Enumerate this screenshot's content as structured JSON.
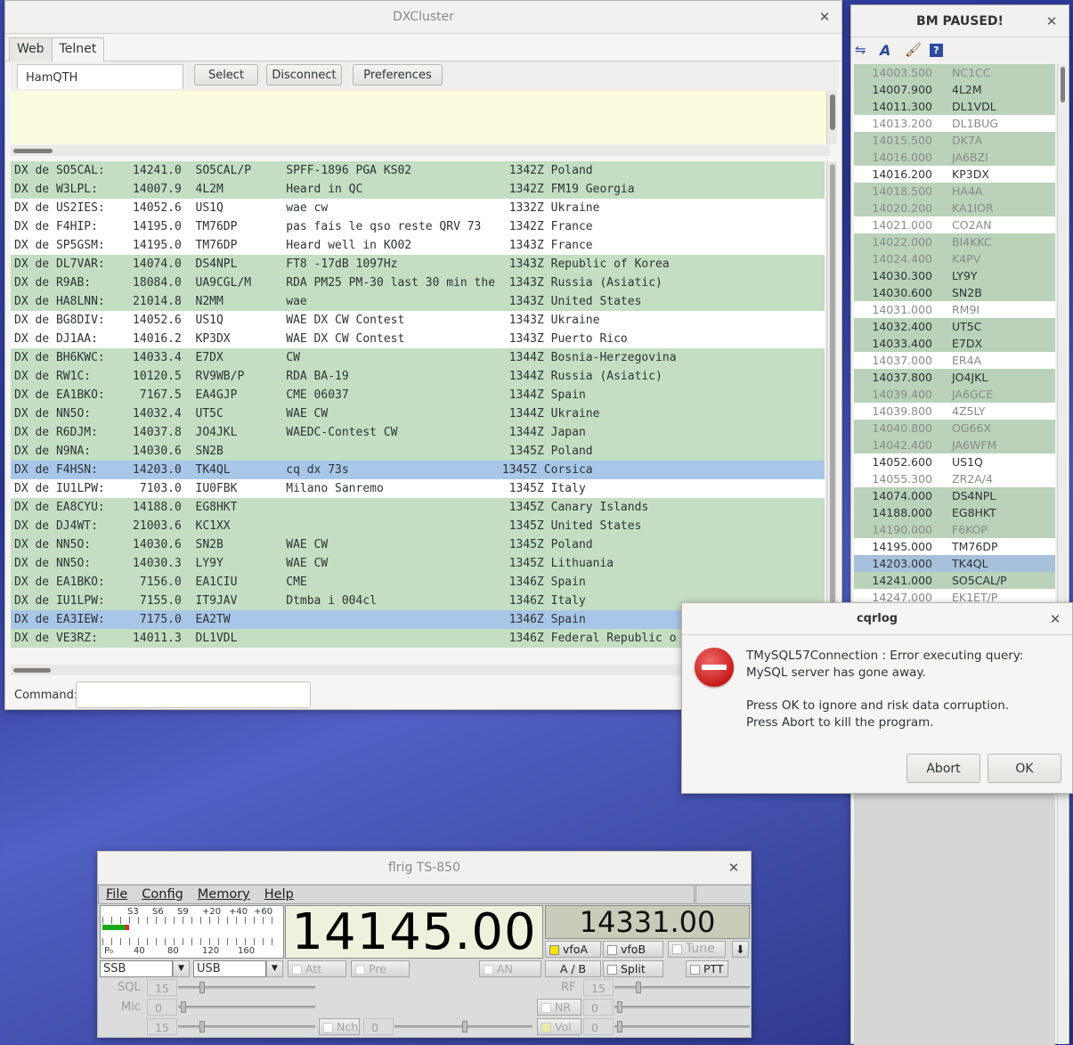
{
  "dxcluster": {
    "title": "DXCluster",
    "tabs": [
      "Web",
      "Telnet"
    ],
    "server": "HamQTH",
    "select_label": "Select",
    "disconnect_label": "Disconnect",
    "preferences_label": "Preferences",
    "command_label": "Command:",
    "rows": [
      {
        "t": "DX de SO5CAL:    14241.0  SO5CAL/P     SPFF-1896 PGA KS02              1342Z Poland",
        "c": "g"
      },
      {
        "t": "DX de W3LPL:     14007.9  4L2M         Heard in QC                     1342Z FM19 Georgia",
        "c": "g"
      },
      {
        "t": "DX de US2IES:    14052.6  US1Q         wae cw                          1332Z Ukraine",
        "c": ""
      },
      {
        "t": "DX de F4HIP:     14195.0  TM76DP       pas fais le qso reste QRV 73    1342Z France",
        "c": ""
      },
      {
        "t": "DX de SP5GSM:    14195.0  TM76DP       Heard well in KO02              1343Z France",
        "c": ""
      },
      {
        "t": "DX de DL7VAR:    14074.0  DS4NPL       FT8 -17dB 1097Hz                1343Z Republic of Korea",
        "c": "g"
      },
      {
        "t": "DX de R9AB:      18084.0  UA9CGL/M     RDA PM25 PM-30 last 30 min the  1343Z Russia (Asiatic)",
        "c": "g"
      },
      {
        "t": "DX de HA8LNN:    21014.8  N2MM         wae                             1343Z United States",
        "c": "g"
      },
      {
        "t": "DX de BG8DIV:    14052.6  US1Q         WAE DX CW Contest               1343Z Ukraine",
        "c": ""
      },
      {
        "t": "DX de DJ1AA:     14016.2  KP3DX        WAE DX CW Contest               1343Z Puerto Rico",
        "c": ""
      },
      {
        "t": "DX de BH6KWC:    14033.4  E7DX         CW                              1344Z Bosnia-Herzegovina",
        "c": "g"
      },
      {
        "t": "DX de RW1C:      10120.5  RV9WB/P      RDA BA-19                       1344Z Russia (Asiatic)",
        "c": "g"
      },
      {
        "t": "DX de EA1BKO:     7167.5  EA4GJP       CME 06037                       1344Z Spain",
        "c": "g"
      },
      {
        "t": "DX de NN5O:      14032.4  UT5C         WAE CW                          1344Z Ukraine",
        "c": "g"
      },
      {
        "t": "DX de R6DJM:     14037.8  JO4JKL       WAEDC-Contest CW                1344Z Japan",
        "c": "g"
      },
      {
        "t": "DX de N9NA:      14030.6  SN2B                                         1345Z Poland",
        "c": "g"
      },
      {
        "t": "DX de F4HSN:     14203.0  TK4QL        cq dx 73s                      1345Z Corsica",
        "c": "b"
      },
      {
        "t": "DX de IU1LPW:     7103.0  IU0FBK       Milano Sanremo                  1345Z Italy",
        "c": ""
      },
      {
        "t": "DX de EA8CYU:    14188.0  EG8HKT                                       1345Z Canary Islands",
        "c": "g"
      },
      {
        "t": "DX de DJ4WT:     21003.6  KC1XX                                        1345Z United States",
        "c": "g"
      },
      {
        "t": "DX de NN5O:      14030.6  SN2B         WAE CW                          1345Z Poland",
        "c": "g"
      },
      {
        "t": "DX de NN5O:      14030.3  LY9Y         WAE CW                          1345Z Lithuania",
        "c": "g"
      },
      {
        "t": "DX de EA1BKO:     7156.0  EA1CIU       CME                             1346Z Spain",
        "c": "g"
      },
      {
        "t": "DX de IU1LPW:     7155.0  IT9JAV       Dtmba i 004cl                   1346Z Italy",
        "c": "g"
      },
      {
        "t": "DX de EA3IEW:     7175.0  EA2TW                                        1346Z Spain",
        "c": "b"
      },
      {
        "t": "DX de VE3RZ:     14011.3  DL1VDL                                       1346Z Federal Republic o",
        "c": "g"
      }
    ]
  },
  "bandmap": {
    "title": "BM PAUSED!",
    "rows": [
      {
        "f": "14003.500",
        "c": "NC1CC",
        "s": "g gray"
      },
      {
        "f": "14007.900",
        "c": "4L2M",
        "s": "g"
      },
      {
        "f": "14011.300",
        "c": "DL1VDL",
        "s": "g"
      },
      {
        "f": "14013.200",
        "c": "DL1BUG",
        "s": "gray"
      },
      {
        "f": "14015.500",
        "c": "DK7A",
        "s": "g gray"
      },
      {
        "f": "14016.000",
        "c": "JA6BZI",
        "s": "g gray"
      },
      {
        "f": "14016.200",
        "c": "KP3DX",
        "s": ""
      },
      {
        "f": "14018.500",
        "c": "HA4A",
        "s": "g gray"
      },
      {
        "f": "14020.200",
        "c": "KA1IOR",
        "s": "g gray"
      },
      {
        "f": "14021.000",
        "c": "CO2AN",
        "s": "gray"
      },
      {
        "f": "14022.000",
        "c": "BI4KKC",
        "s": "g gray"
      },
      {
        "f": "14024.400",
        "c": "K4PV",
        "s": "g gray"
      },
      {
        "f": "14030.300",
        "c": "LY9Y",
        "s": "g"
      },
      {
        "f": "14030.600",
        "c": "SN2B",
        "s": "g"
      },
      {
        "f": "14031.000",
        "c": "RM9I",
        "s": "gray"
      },
      {
        "f": "14032.400",
        "c": "UT5C",
        "s": "g"
      },
      {
        "f": "14033.400",
        "c": "E7DX",
        "s": "g"
      },
      {
        "f": "14037.000",
        "c": "ER4A",
        "s": "gray"
      },
      {
        "f": "14037.800",
        "c": "JO4JKL",
        "s": "g"
      },
      {
        "f": "14039.400",
        "c": "JA6GCE",
        "s": "g gray"
      },
      {
        "f": "14039.800",
        "c": "4Z5LY",
        "s": "gray"
      },
      {
        "f": "14040.800",
        "c": "OG66X",
        "s": "g gray"
      },
      {
        "f": "14042.400",
        "c": "JA6WFM",
        "s": "g gray"
      },
      {
        "f": "14052.600",
        "c": "US1Q",
        "s": ""
      },
      {
        "f": "14055.300",
        "c": "ZR2A/4",
        "s": "gray"
      },
      {
        "f": "14074.000",
        "c": "DS4NPL",
        "s": "g"
      },
      {
        "f": "14188.000",
        "c": "EG8HKT",
        "s": "g"
      },
      {
        "f": "14190.000",
        "c": "F6KOP",
        "s": "g gray"
      },
      {
        "f": "14195.000",
        "c": "TM76DP",
        "s": ""
      },
      {
        "f": "14203.000",
        "c": "TK4QL",
        "s": "b"
      },
      {
        "f": "14241.000",
        "c": "SO5CAL/P",
        "s": "g"
      },
      {
        "f": "14247.000",
        "c": "EK1ET/P",
        "s": "gray"
      }
    ]
  },
  "dialog": {
    "title": "cqrlog",
    "message": "TMySQL57Connection : Error executing query: MySQL server has gone away.",
    "hint1": "Press OK to ignore and risk data corruption.",
    "hint2": "Press Abort to kill the program.",
    "abort_label": "Abort",
    "ok_label": "OK"
  },
  "flrig": {
    "title": "flrig TS-850",
    "menu": [
      "File",
      "Config",
      "Memory",
      "Help"
    ],
    "smeter_top": [
      "S3",
      "S6",
      "S9",
      "+20",
      "+40",
      "+60"
    ],
    "smeter_bottom": [
      "P₀",
      "40",
      "80",
      "120",
      "160"
    ],
    "smeter_level": 0.15,
    "freq_a": "14145.00",
    "freq_b": "14331.00",
    "vfoa": "vfoA",
    "vfob": "vfoB",
    "tune": "Tune",
    "ab": "A / B",
    "split": "Split",
    "ptt": "PTT",
    "mode": "SSB",
    "bw": "USB",
    "att": "Att",
    "pre": "Pre",
    "an": "AN",
    "sql_label": "SQL",
    "sql_val": "15",
    "mic_label": "Mic",
    "mic_val": "0",
    "rf_label": "RF",
    "rf_val": "15",
    "nr_label": "NR",
    "nr_val": "0",
    "row3_val": "15",
    "nch_label": "Nch",
    "nch_val": "0",
    "vol_label": "Vol",
    "vol_val": "0",
    "arrow": "⬇"
  }
}
